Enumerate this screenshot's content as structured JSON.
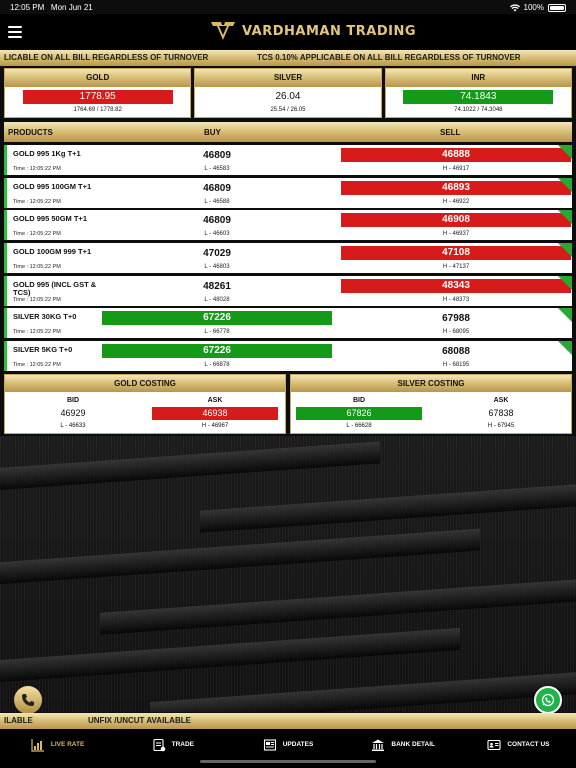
{
  "status": {
    "time": "12:05 PM",
    "date": "Mon Jun 21",
    "battery": "100%"
  },
  "header": {
    "brand": "VARDHAMAN TRADING"
  },
  "ticker_top": {
    "left": "LICABLE ON ALL BILL REGARDLESS OF TURNOVER",
    "right": "TCS 0.10% APPLICABLE ON ALL BILL REGARDLESS OF TURNOVER"
  },
  "rates": {
    "gold": {
      "label": "GOLD",
      "value": "1778.95",
      "range": "1764.69 / 1778.82"
    },
    "silver": {
      "label": "SILVER",
      "value": "26.04",
      "range": "25.54 / 26.05"
    },
    "inr": {
      "label": "INR",
      "value": "74.1843",
      "range": "74.1022 / 74.3048"
    }
  },
  "table": {
    "products": "PRODUCTS",
    "buy": "BUY",
    "sell": "SELL"
  },
  "rows": [
    {
      "name": "GOLD 995 1Kg  T+1",
      "time": "Time : 12:05:22 PM",
      "buy": "46809",
      "low": "L - 46583",
      "sell": "46888",
      "high": "H - 46917"
    },
    {
      "name": "GOLD 995 100GM T+1",
      "time": "Time : 12:05:22 PM",
      "buy": "46809",
      "low": "L - 46588",
      "sell": "46893",
      "high": "H - 46922"
    },
    {
      "name": "GOLD 995 50GM T+1",
      "time": "Time : 12:05:22 PM",
      "buy": "46809",
      "low": "L - 46603",
      "sell": "46908",
      "high": "H - 46937"
    },
    {
      "name": "GOLD 100GM 999 T+1",
      "time": "Time : 12:05:22 PM",
      "buy": "47029",
      "low": "L - 46803",
      "sell": "47108",
      "high": "H - 47137"
    },
    {
      "name": "GOLD 995 (INCL GST & TCS)",
      "time": "Time : 12:05:22 PM",
      "buy": "48261",
      "low": "L - 48028",
      "sell": "48343",
      "high": "H - 48373"
    },
    {
      "name": "SILVER 30KG T+0",
      "time": "Time : 12:05:22 PM",
      "buy": "67226",
      "low": "L - 66778",
      "sell": "67988",
      "high": "H - 68095"
    },
    {
      "name": "SILVER 5KG T+0",
      "time": "Time : 12:05:22 PM",
      "buy": "67226",
      "low": "L - 66878",
      "sell": "68088",
      "high": "H - 68195"
    }
  ],
  "costing": {
    "gold": {
      "title": "GOLD COSTING",
      "bid_label": "BID",
      "ask_label": "ASK",
      "bid": "46929",
      "ask": "46938",
      "low": "L - 46633",
      "high": "H - 46967"
    },
    "silver": {
      "title": "SILVER COSTING",
      "bid_label": "BID",
      "ask_label": "ASK",
      "bid": "67826",
      "ask": "67838",
      "low": "L - 66628",
      "high": "H - 67945"
    }
  },
  "ticker_bottom": {
    "left": "ILABLE",
    "right": "UNFIX /UNCUT AVAILABLE"
  },
  "tabs": [
    {
      "label": "LIVE RATE",
      "icon": "chart-icon"
    },
    {
      "label": "TRADE",
      "icon": "trade-icon"
    },
    {
      "label": "UPDATES",
      "icon": "updates-icon"
    },
    {
      "label": "BANK DETAIL",
      "icon": "bank-icon"
    },
    {
      "label": "CONTACT US",
      "icon": "contact-icon"
    }
  ],
  "colors": {
    "accent": "#d9b964",
    "up": "#159a17",
    "down": "#d71a1a"
  }
}
